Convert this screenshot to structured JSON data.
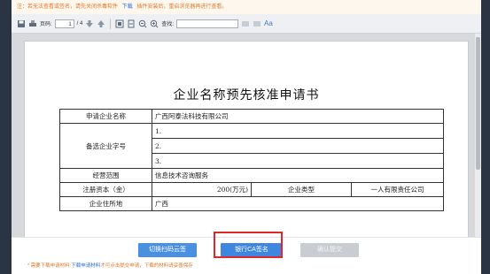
{
  "notice": {
    "text_before": "注：若无法查看或签名，请先关闭杀毒软件",
    "download_link": "下载",
    "text_after": "插件安装后，重启浏览器再进行查看。"
  },
  "toolbar": {
    "page_label": "页码:",
    "page_current": "1",
    "page_total": "/ 4",
    "find_label": "查找:",
    "find_value": "",
    "font_label": "Aa"
  },
  "document": {
    "title": "企业名称预先核准申请书",
    "rows": {
      "applicant_label": "申请企业名称",
      "applicant_value": "广西阿泰法科技有限公司",
      "alt_label": "备选企业字号",
      "alt1": "1.",
      "alt2": "2.",
      "alt3": "3.",
      "scope_label": "经营范围",
      "scope_value": "信息技术咨询服务",
      "capital_label": "注册资本（金）",
      "capital_value": "200(万元)",
      "type_label": "企业类型",
      "type_value": "一人有限责任公司",
      "cut_label": "企业住所地",
      "cut_value": "广西"
    }
  },
  "buttons": {
    "scan": "切换扫码云签",
    "ca": "银行CA签名",
    "confirm": "确认提交"
  },
  "bottom_note": {
    "prefix": "* 需要下载申请材料:",
    "link1": "下载申请材料",
    "middle": "才可点击提交申请，下载的材料请妥善保存"
  }
}
